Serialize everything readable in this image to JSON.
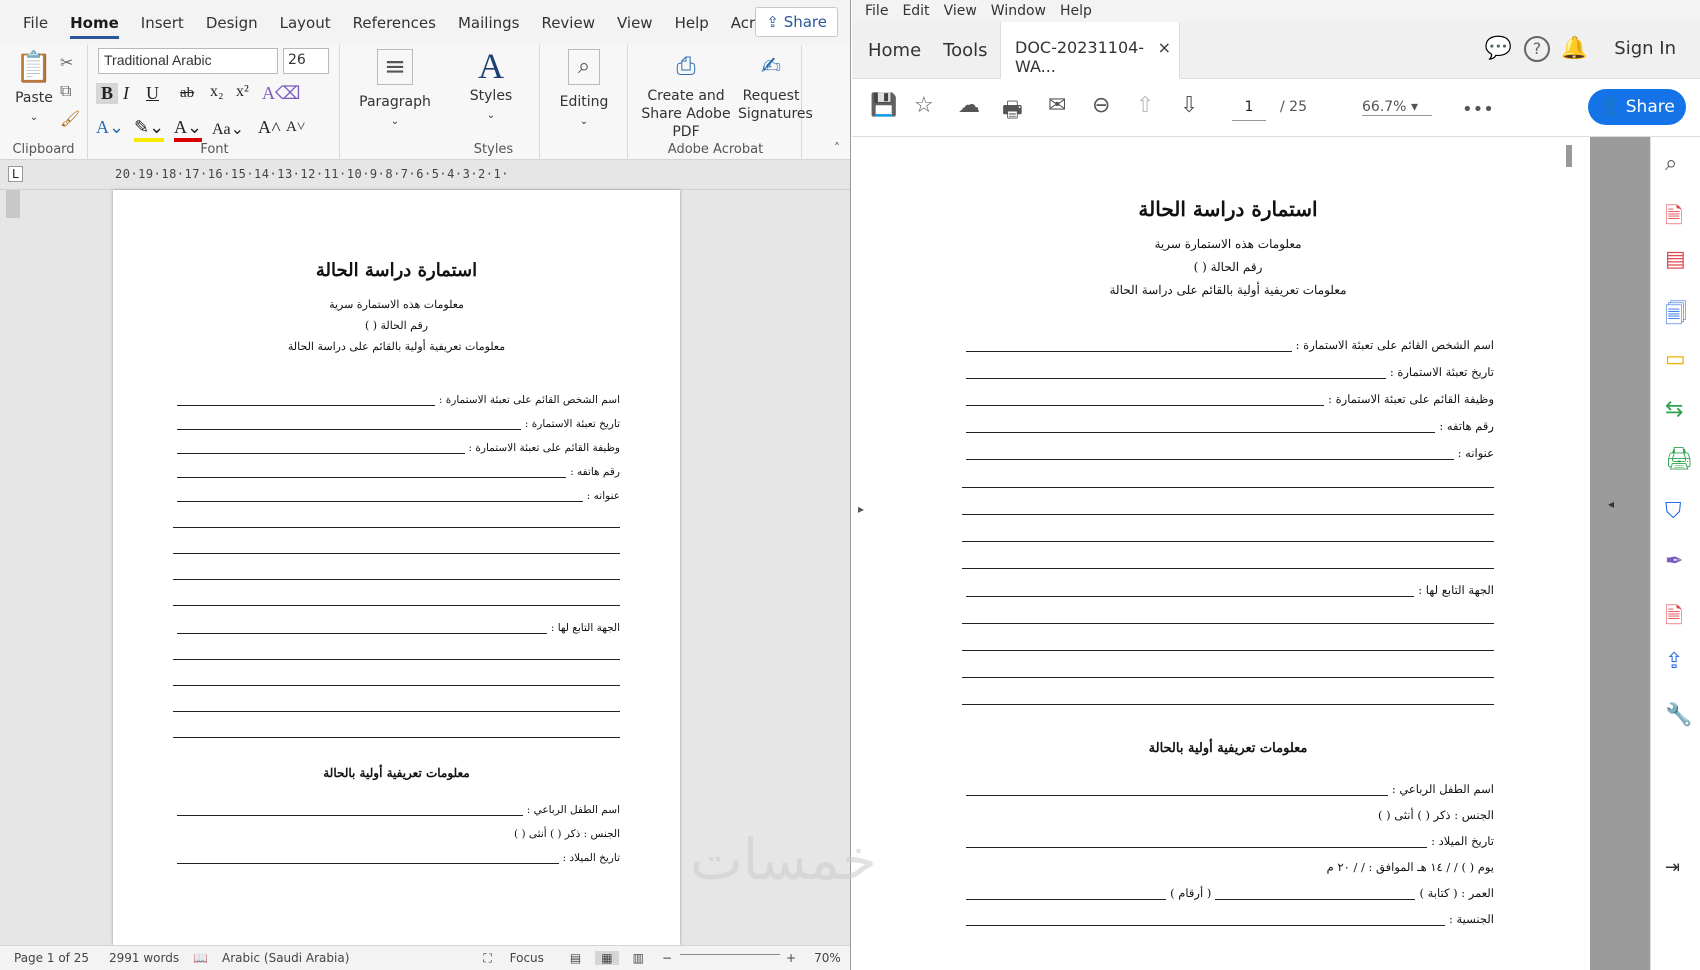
{
  "word": {
    "tabs": [
      "File",
      "Home",
      "Insert",
      "Design",
      "Layout",
      "References",
      "Mailings",
      "Review",
      "View",
      "Help",
      "Acrobat"
    ],
    "share_label": "Share",
    "ribbon": {
      "paste_label": "Paste",
      "font_name": "Traditional Arabic",
      "font_size": "26",
      "paragraph_label": "Paragraph",
      "styles_label": "Styles",
      "editing_label": "Editing",
      "create_share_label": "Create and Share Adobe PDF",
      "request_sig_label": "Request Signatures",
      "group_clipboard": "Clipboard",
      "group_font": "Font",
      "group_styles": "Styles",
      "group_acrobat": "Adobe Acrobat",
      "bold": "B",
      "italic": "I",
      "underline": "U",
      "strike": "ab",
      "sub": "x₂",
      "sup": "x²"
    },
    "ruler_numbers": "20·19·18·17·16·15·14·13·12·11·10·9·8·7·6·5·4·3·2·1·",
    "status": {
      "page": "Page 1 of 25",
      "words": "2991 words",
      "language": "Arabic (Saudi Arabia)",
      "focus": "Focus",
      "zoom": "70%"
    }
  },
  "acrobat": {
    "menu": [
      "File",
      "Edit",
      "View",
      "Window",
      "Help"
    ],
    "tabs": [
      "Home",
      "Tools"
    ],
    "doc_tab": "DOC-20231104-WA...",
    "sign_in": "Sign In",
    "page_current": "1",
    "page_total": "/ 25",
    "zoom": "66.7%",
    "share_label": "Share"
  },
  "document": {
    "title": "استمارة دراسة الحالة",
    "line1": "معلومات هذه الاستمارة سرية",
    "line2": "رقم الحالة (      )",
    "line3": "معلومات تعريفية أولية بالقائم على دراسة الحالة",
    "f1": "اسم الشخص القائم على تعبئة الاستمارة :",
    "f2": "تاريخ تعبئة الاستمارة :",
    "f3": "وظيفة القائم على تعبئة الاستمارة :",
    "f4": "رقم هاتفه :",
    "f5": "عنوانه :",
    "f6": "الجهة التابع لها :",
    "section2": "معلومات تعريفية أولية بالحالة",
    "g1": "اسم الطفل الرباعي :",
    "g2": "الجنس :  ذكر (      )        أنثى (      )",
    "g3": "تاريخ الميلاد :",
    "g4": "يوم (        )    /    /    ١٤ هـ الموافق :    /    /    ٢٠ م",
    "g5a": "العمر : ( كتابة )",
    "g5b": "( أرقام )",
    "g6": "الجنسية :"
  },
  "watermark": "خمسات"
}
